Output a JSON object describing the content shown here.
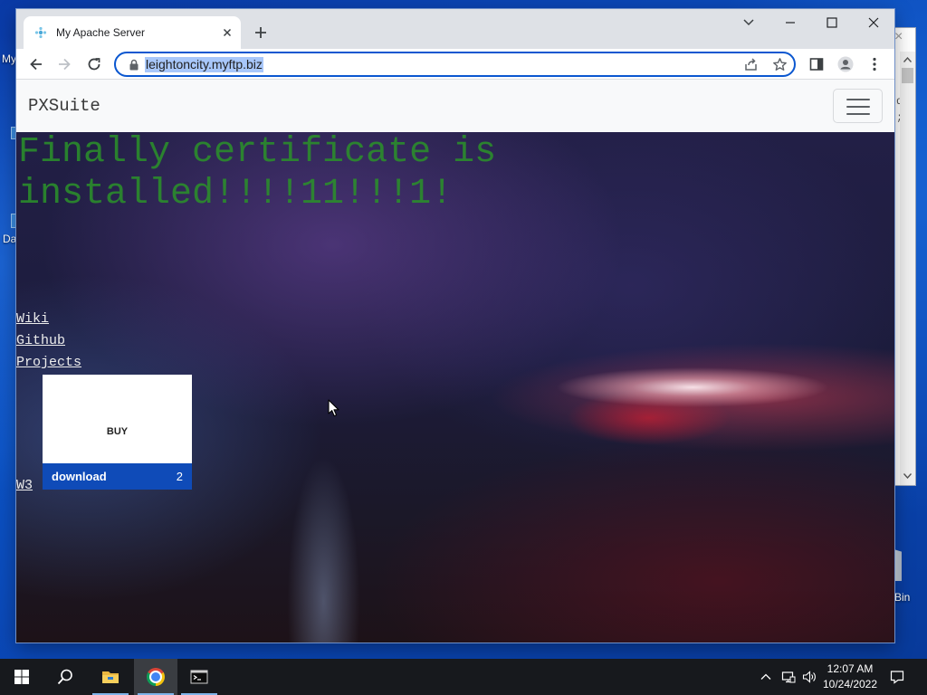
{
  "desktop": {
    "icons": [
      {
        "label": "My"
      },
      {
        "label": "Da"
      },
      {
        "label": "Bin"
      }
    ]
  },
  "background_window": {
    "close_glyph": "×",
    "text_lines": [
      "d",
      ";"
    ]
  },
  "browser": {
    "tab": {
      "title": "My Apache Server",
      "favicon": "apache-favicon-icon"
    },
    "address": {
      "url": "leightoncity.myftp.biz"
    },
    "icons": [
      "back-icon",
      "forward-icon",
      "reload-icon",
      "lock-icon",
      "share-icon",
      "star-icon",
      "side-panel-icon",
      "profile-icon",
      "menu-icon"
    ]
  },
  "page": {
    "navbar": {
      "brand": "PXSuite"
    },
    "heading": "Finally certificate is installed!!!!11!!!1!",
    "links": [
      "Wiki",
      "Github",
      "Projects"
    ],
    "popup": {
      "center_label": "BUY",
      "bar_label": "download",
      "bar_count": "2"
    },
    "w3_link": "W3"
  },
  "taskbar": {
    "apps": [
      "start-icon",
      "search-icon",
      "file-explorer-icon",
      "chrome-icon",
      "terminal-icon"
    ],
    "time": "12:07 AM",
    "date": "10/24/2022"
  },
  "colors": {
    "heading": "#2b8f2b",
    "omnibox_focus": "#0b57d0",
    "url_selection": "#a8c7fa",
    "popup_bar": "#0f4bb8",
    "taskbar": "#17191d"
  }
}
